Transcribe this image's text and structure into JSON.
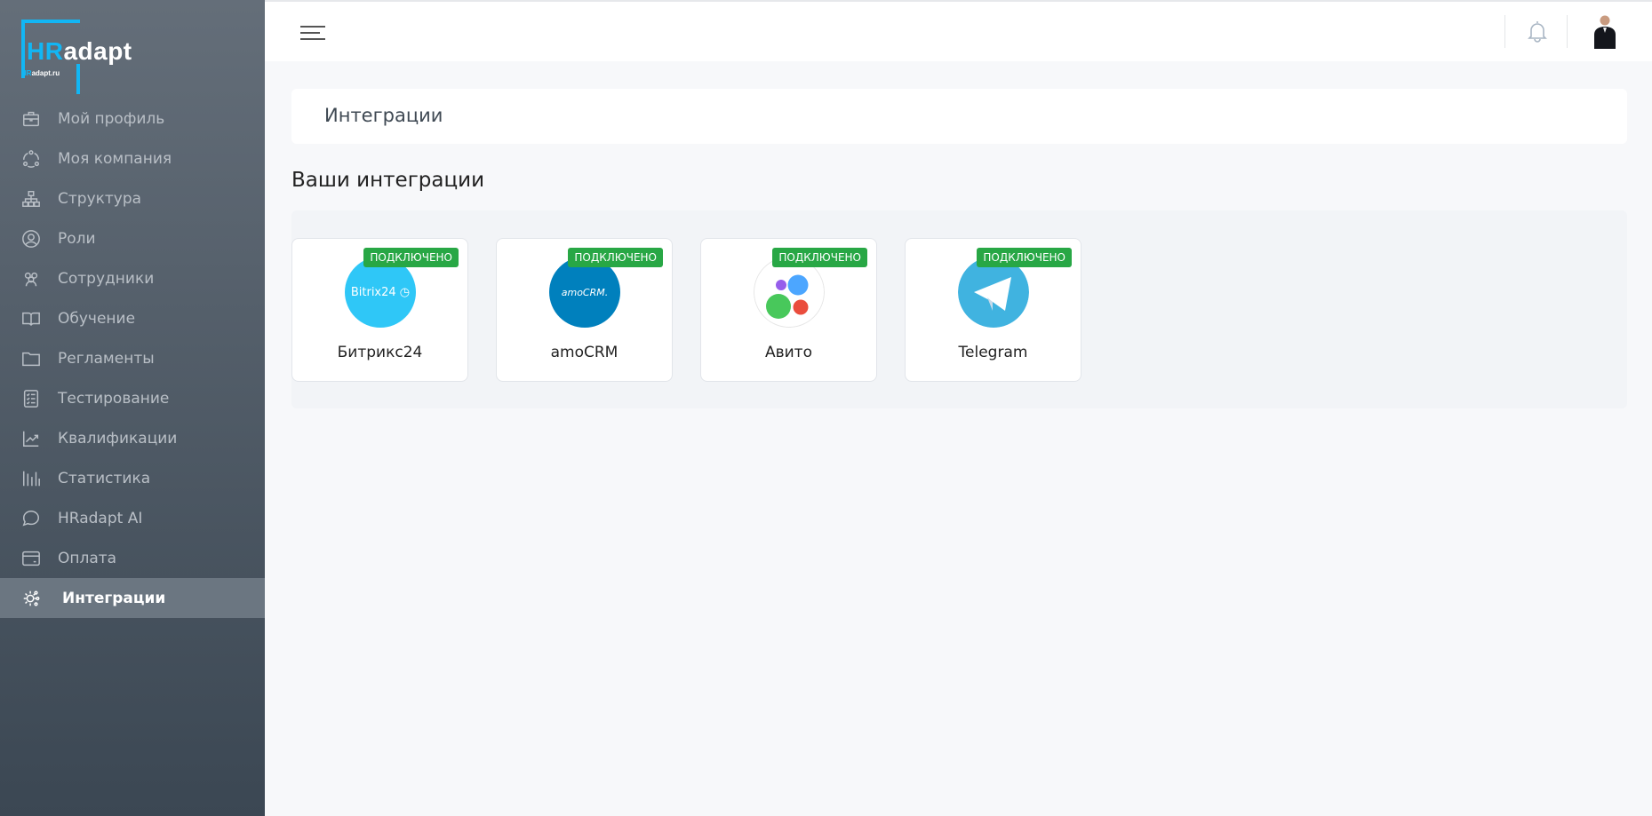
{
  "logo": {
    "text_hr": "HR",
    "text_adapt": "adapt",
    "domain_hr": "HR",
    "domain_rest": "adapt.ru"
  },
  "sidebar": {
    "items": [
      {
        "label": "Мой профиль",
        "icon": "briefcase-icon"
      },
      {
        "label": "Моя компания",
        "icon": "company-network-icon"
      },
      {
        "label": "Структура",
        "icon": "structure-icon"
      },
      {
        "label": "Роли",
        "icon": "user-circle-icon"
      },
      {
        "label": "Сотрудники",
        "icon": "users-icon"
      },
      {
        "label": "Обучение",
        "icon": "book-icon"
      },
      {
        "label": "Регламенты",
        "icon": "folder-icon"
      },
      {
        "label": "Тестирование",
        "icon": "checklist-icon"
      },
      {
        "label": "Квалификации",
        "icon": "chart-line-icon"
      },
      {
        "label": "Статистика",
        "icon": "bar-stats-icon"
      },
      {
        "label": "HRadapt AI",
        "icon": "chat-icon"
      },
      {
        "label": "Оплата",
        "icon": "card-icon"
      },
      {
        "label": "Интеграции",
        "icon": "gear-integrations-icon",
        "active": true
      }
    ]
  },
  "page": {
    "title": "Интеграции",
    "section_title": "Ваши интеграции"
  },
  "integrations": [
    {
      "name": "Битрикс24",
      "status": "ПОДКЛЮЧЕНО",
      "logo_text": "Bitrix24",
      "color": "#2fc7f7"
    },
    {
      "name": "amoCRM",
      "status": "ПОДКЛЮЧЕНО",
      "logo_text": "amoCRM.",
      "color": "#0080bd"
    },
    {
      "name": "Авито",
      "status": "ПОДКЛЮЧЕНО",
      "color": "#ffffff"
    },
    {
      "name": "Telegram",
      "status": "ПОДКЛЮЧЕНО",
      "color": "#40b3e0"
    }
  ],
  "colors": {
    "badge": "#28a745",
    "accent": "#12b6f4"
  }
}
